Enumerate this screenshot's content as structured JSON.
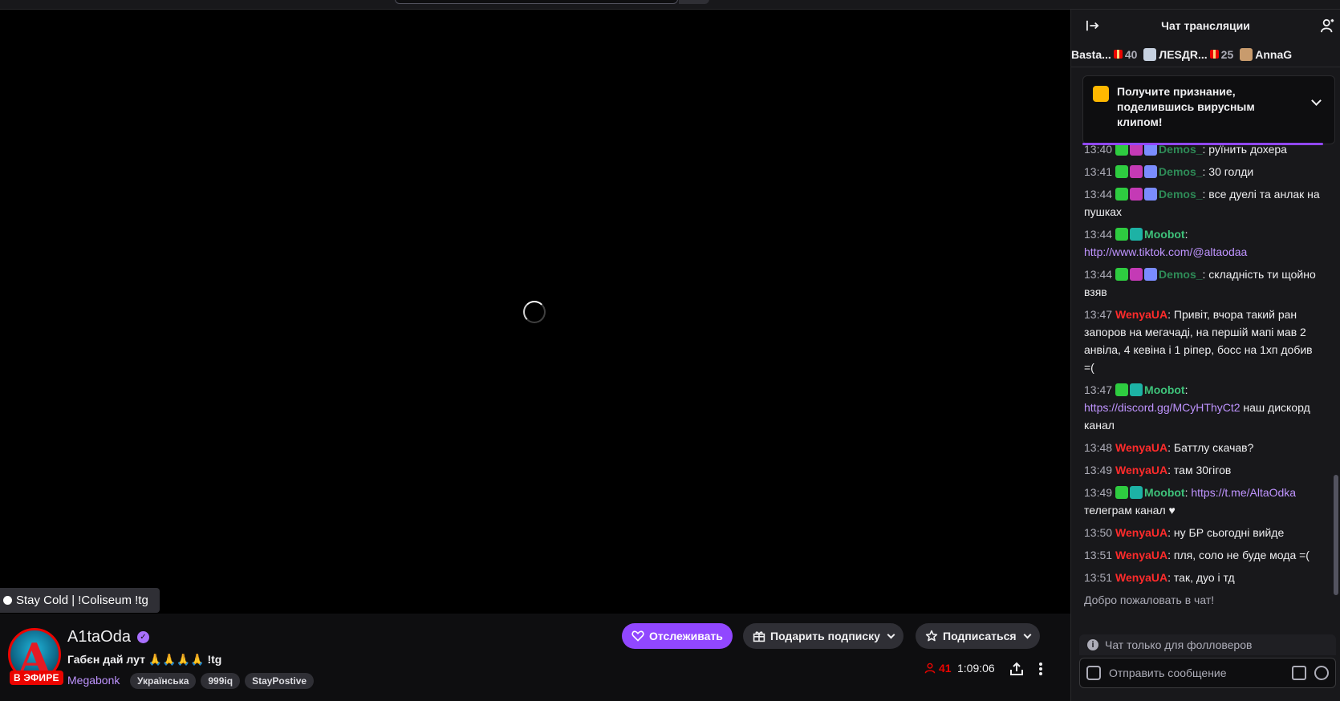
{
  "player": {
    "overlay_title": "Stay Cold | !Coliseum !tg"
  },
  "stream": {
    "channel_name": "A1taOda",
    "live_badge": "В ЭФИРЕ",
    "title": "Габєн дай лут 🙏🙏🙏🙏 !tg",
    "category": "Megabonk",
    "tags": [
      "Українська",
      "999iq",
      "StayPostive"
    ],
    "viewers": "41",
    "uptime": "1:09:06",
    "follow_label": "Отслеживать",
    "gift_label": "Подарить подписку",
    "subscribe_label": "Подписаться"
  },
  "chat": {
    "header_title": "Чат трансляции",
    "leaderboard": [
      {
        "name": "Basta...",
        "count": "40"
      },
      {
        "name": "ЛЕЅДR...",
        "count": "25"
      },
      {
        "name": "AnnaG",
        "count": ""
      }
    ],
    "promo_text": "Получите признание, поделившись вирусным клипом!",
    "messages": [
      {
        "time": "13:40",
        "author": "Demos_",
        "kind": "demos",
        "text": ": руїнить дохера"
      },
      {
        "time": "13:41",
        "author": "Demos_",
        "kind": "demos",
        "text": ": 30 голди"
      },
      {
        "time": "13:44",
        "author": "Demos_",
        "kind": "demos",
        "text": ": все дуелі та анлак на пушках"
      },
      {
        "time": "13:44",
        "author": "Moobot",
        "kind": "moobot",
        "text": ": ",
        "link": "http://www.tiktok.com/@altaodaa",
        "after": ""
      },
      {
        "time": "13:44",
        "author": "Demos_",
        "kind": "demos",
        "text": ": складність ти щойно взяв"
      },
      {
        "time": "13:47",
        "author": "WenyaUA",
        "kind": "wenya",
        "text": ": Привіт, вчора такий ран запоров на мегачаді, на першій мапі мав 2 анвіла, 4 кевіна і 1 ріпер, босс на 1хп добив =("
      },
      {
        "time": "13:47",
        "author": "Moobot",
        "kind": "moobot",
        "text": ": ",
        "link": "https://discord.gg/MCyHThyCt2",
        "after": " наш дискорд канал"
      },
      {
        "time": "13:48",
        "author": "WenyaUA",
        "kind": "wenya",
        "text": ": Баттлу скачав?"
      },
      {
        "time": "13:49",
        "author": "WenyaUA",
        "kind": "wenya",
        "text": ": там 30гігов"
      },
      {
        "time": "13:49",
        "author": "Moobot",
        "kind": "moobot",
        "text": ": ",
        "link": "https://t.me/AltaOdka",
        "after": " телеграм канал ♥"
      },
      {
        "time": "13:50",
        "author": "WenyaUA",
        "kind": "wenya",
        "text": ": ну БР сьогодні вийде"
      },
      {
        "time": "13:51",
        "author": "WenyaUA",
        "kind": "wenya",
        "text": ": пля, соло не буде мода =("
      },
      {
        "time": "13:51",
        "author": "WenyaUA",
        "kind": "wenya",
        "text": ": так, дуо і тд"
      }
    ],
    "welcome": "Добро пожаловать в чат!",
    "followers_only": "Чат только для фолловеров",
    "input_placeholder": "Отправить сообщение"
  }
}
